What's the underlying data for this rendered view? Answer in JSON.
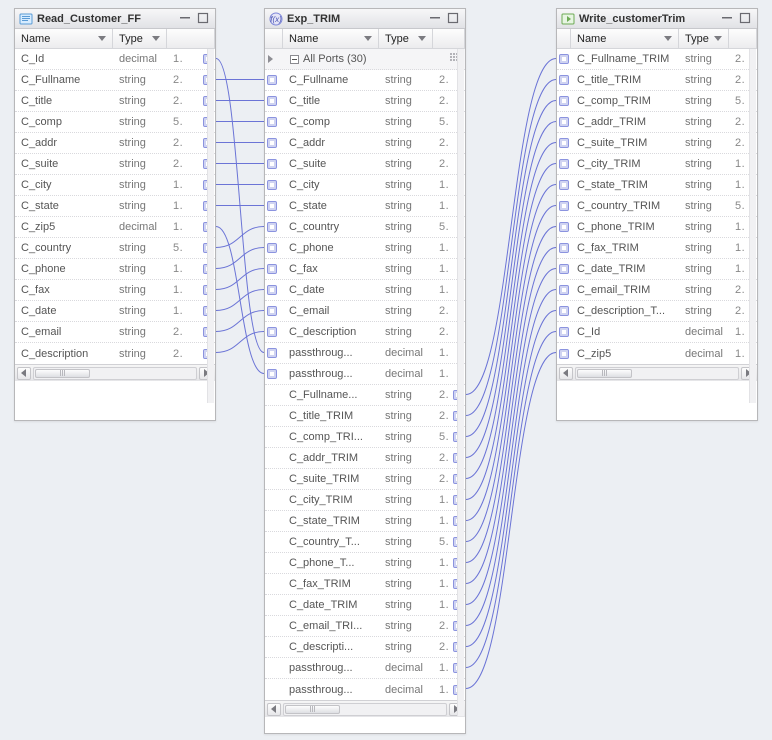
{
  "columns": {
    "name": "Name",
    "type": "Type"
  },
  "panels": [
    {
      "id": "p1",
      "title": "Read_Customer_FF",
      "kind": "source",
      "ports": [
        {
          "name": "C_Id",
          "type": "decimal",
          "num": "1"
        },
        {
          "name": "C_Fullname",
          "type": "string",
          "num": "2"
        },
        {
          "name": "C_title",
          "type": "string",
          "num": "2"
        },
        {
          "name": "C_comp",
          "type": "string",
          "num": "5"
        },
        {
          "name": "C_addr",
          "type": "string",
          "num": "2"
        },
        {
          "name": "C_suite",
          "type": "string",
          "num": "2"
        },
        {
          "name": "C_city",
          "type": "string",
          "num": "1"
        },
        {
          "name": "C_state",
          "type": "string",
          "num": "1"
        },
        {
          "name": "C_zip5",
          "type": "decimal",
          "num": "1"
        },
        {
          "name": "C_country",
          "type": "string",
          "num": "5"
        },
        {
          "name": "C_phone",
          "type": "string",
          "num": "1"
        },
        {
          "name": "C_fax",
          "type": "string",
          "num": "1"
        },
        {
          "name": "C_date",
          "type": "string",
          "num": "1"
        },
        {
          "name": "C_email",
          "type": "string",
          "num": "2"
        },
        {
          "name": "C_description",
          "type": "string",
          "num": "2"
        }
      ]
    },
    {
      "id": "p2",
      "title": "Exp_TRIM",
      "kind": "expression",
      "group_label": "All Ports (30)",
      "ports": [
        {
          "name": "C_Fullname",
          "type": "string",
          "num": "2",
          "in": true
        },
        {
          "name": "C_title",
          "type": "string",
          "num": "2",
          "in": true
        },
        {
          "name": "C_comp",
          "type": "string",
          "num": "5",
          "in": true
        },
        {
          "name": "C_addr",
          "type": "string",
          "num": "2",
          "in": true
        },
        {
          "name": "C_suite",
          "type": "string",
          "num": "2",
          "in": true
        },
        {
          "name": "C_city",
          "type": "string",
          "num": "1",
          "in": true
        },
        {
          "name": "C_state",
          "type": "string",
          "num": "1",
          "in": true
        },
        {
          "name": "C_country",
          "type": "string",
          "num": "5",
          "in": true
        },
        {
          "name": "C_phone",
          "type": "string",
          "num": "1",
          "in": true
        },
        {
          "name": "C_fax",
          "type": "string",
          "num": "1",
          "in": true
        },
        {
          "name": "C_date",
          "type": "string",
          "num": "1",
          "in": true
        },
        {
          "name": "C_email",
          "type": "string",
          "num": "2",
          "in": true
        },
        {
          "name": "C_description",
          "type": "string",
          "num": "2",
          "in": true
        },
        {
          "name": "passthroug...",
          "type": "decimal",
          "num": "1",
          "in": true
        },
        {
          "name": "passthroug...",
          "type": "decimal",
          "num": "1",
          "in": true
        },
        {
          "name": "C_Fullname...",
          "type": "string",
          "num": "2",
          "out": true
        },
        {
          "name": "C_title_TRIM",
          "type": "string",
          "num": "2",
          "out": true
        },
        {
          "name": "C_comp_TRI...",
          "type": "string",
          "num": "5",
          "out": true
        },
        {
          "name": "C_addr_TRIM",
          "type": "string",
          "num": "2",
          "out": true
        },
        {
          "name": "C_suite_TRIM",
          "type": "string",
          "num": "2",
          "out": true
        },
        {
          "name": "C_city_TRIM",
          "type": "string",
          "num": "1",
          "out": true
        },
        {
          "name": "C_state_TRIM",
          "type": "string",
          "num": "1",
          "out": true
        },
        {
          "name": "C_country_T...",
          "type": "string",
          "num": "5",
          "out": true
        },
        {
          "name": "C_phone_T...",
          "type": "string",
          "num": "1",
          "out": true
        },
        {
          "name": "C_fax_TRIM",
          "type": "string",
          "num": "1",
          "out": true
        },
        {
          "name": "C_date_TRIM",
          "type": "string",
          "num": "1",
          "out": true
        },
        {
          "name": "C_email_TRI...",
          "type": "string",
          "num": "2",
          "out": true
        },
        {
          "name": "C_descripti...",
          "type": "string",
          "num": "2",
          "out": true
        },
        {
          "name": "passthroug...",
          "type": "decimal",
          "num": "1",
          "out": true
        },
        {
          "name": "passthroug...",
          "type": "decimal",
          "num": "1",
          "out": true
        }
      ]
    },
    {
      "id": "p3",
      "title": "Write_customerTrim",
      "kind": "target",
      "ports": [
        {
          "name": "C_Fullname_TRIM",
          "type": "string",
          "num": "2"
        },
        {
          "name": "C_title_TRIM",
          "type": "string",
          "num": "2"
        },
        {
          "name": "C_comp_TRIM",
          "type": "string",
          "num": "5"
        },
        {
          "name": "C_addr_TRIM",
          "type": "string",
          "num": "2"
        },
        {
          "name": "C_suite_TRIM",
          "type": "string",
          "num": "2"
        },
        {
          "name": "C_city_TRIM",
          "type": "string",
          "num": "1"
        },
        {
          "name": "C_state_TRIM",
          "type": "string",
          "num": "1"
        },
        {
          "name": "C_country_TRIM",
          "type": "string",
          "num": "5"
        },
        {
          "name": "C_phone_TRIM",
          "type": "string",
          "num": "1"
        },
        {
          "name": "C_fax_TRIM",
          "type": "string",
          "num": "1"
        },
        {
          "name": "C_date_TRIM",
          "type": "string",
          "num": "1"
        },
        {
          "name": "C_email_TRIM",
          "type": "string",
          "num": "2"
        },
        {
          "name": "C_description_T...",
          "type": "string",
          "num": "2"
        },
        {
          "name": "C_Id",
          "type": "decimal",
          "num": "1"
        },
        {
          "name": "C_zip5",
          "type": "decimal",
          "num": "1"
        }
      ]
    }
  ],
  "links_1_to_2": [
    [
      1,
      0
    ],
    [
      2,
      1
    ],
    [
      3,
      2
    ],
    [
      4,
      3
    ],
    [
      5,
      4
    ],
    [
      6,
      5
    ],
    [
      7,
      6
    ],
    [
      9,
      7
    ],
    [
      10,
      8
    ],
    [
      11,
      9
    ],
    [
      12,
      10
    ],
    [
      13,
      11
    ],
    [
      14,
      12
    ],
    [
      0,
      13
    ],
    [
      8,
      14
    ]
  ],
  "links_2_to_3": [
    [
      15,
      0
    ],
    [
      16,
      1
    ],
    [
      17,
      2
    ],
    [
      18,
      3
    ],
    [
      19,
      4
    ],
    [
      20,
      5
    ],
    [
      21,
      6
    ],
    [
      22,
      7
    ],
    [
      23,
      8
    ],
    [
      24,
      9
    ],
    [
      25,
      10
    ],
    [
      26,
      11
    ],
    [
      27,
      12
    ],
    [
      28,
      13
    ],
    [
      29,
      14
    ]
  ]
}
